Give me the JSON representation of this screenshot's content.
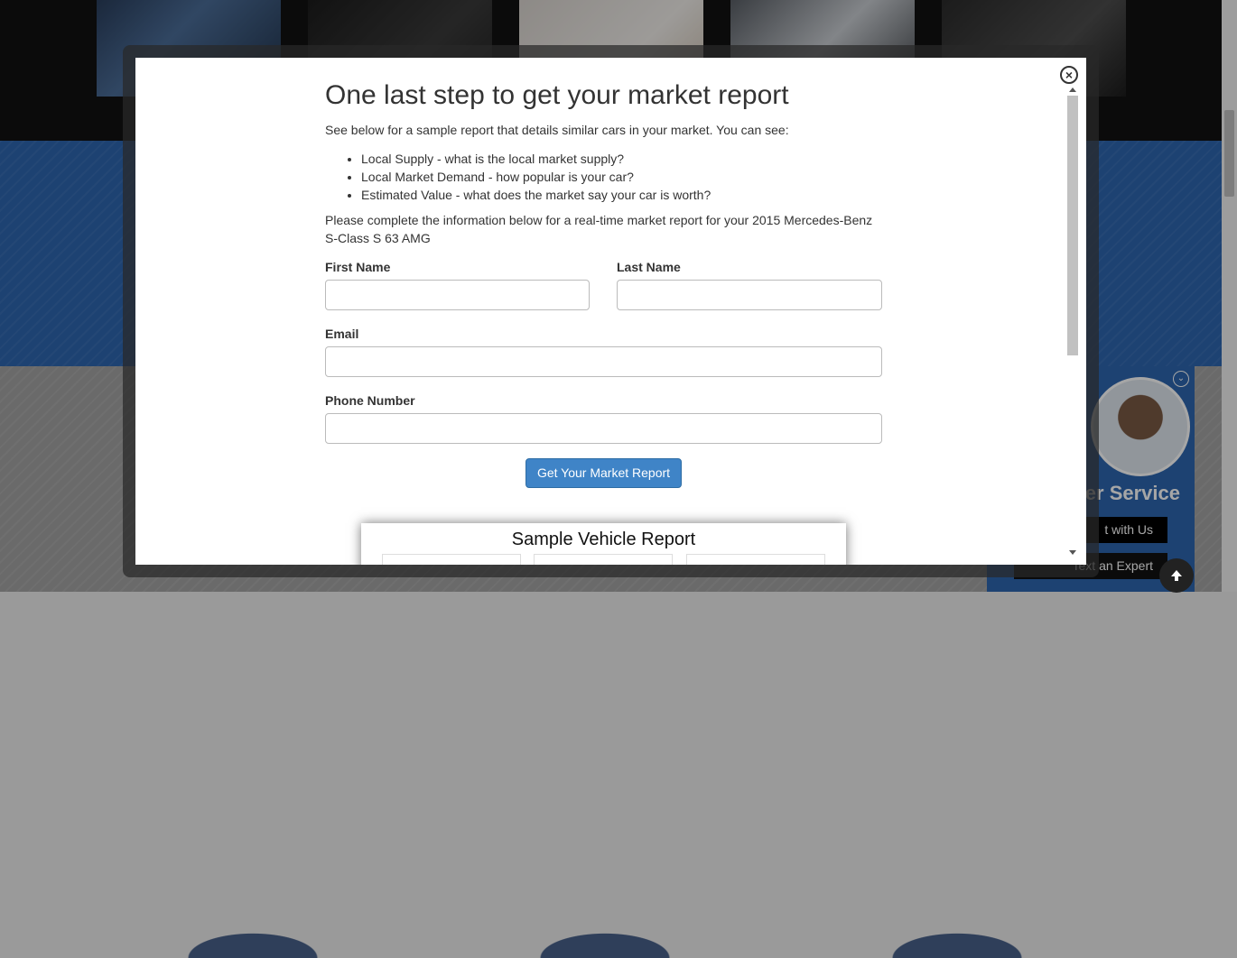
{
  "background": {
    "chat_widget": {
      "title": "er Service",
      "chat_button": "t with Us",
      "text_button": "Text an Expert"
    },
    "scroll_top_icon": "arrow-up-icon"
  },
  "modal": {
    "title": "One last step to get your market report",
    "intro": "See below for a sample report that details similar cars in your market. You can see:",
    "features": [
      "Local Supply - what is the local market supply?",
      "Local Market Demand - how popular is your car?",
      "Estimated Value - what does the market say your car is worth?"
    ],
    "paragraph": "Please complete the information below for a real-time market report for your 2015 Mercedes-Benz S-Class S 63 AMG",
    "form": {
      "first_name_label": "First Name",
      "first_name_value": "",
      "last_name_label": "Last Name",
      "last_name_value": "",
      "email_label": "Email",
      "email_value": "",
      "phone_label": "Phone Number",
      "phone_value": "",
      "submit_label": "Get Your Market Report"
    },
    "sample_report_title": "Sample Vehicle Report",
    "close_icon": "close-icon"
  }
}
